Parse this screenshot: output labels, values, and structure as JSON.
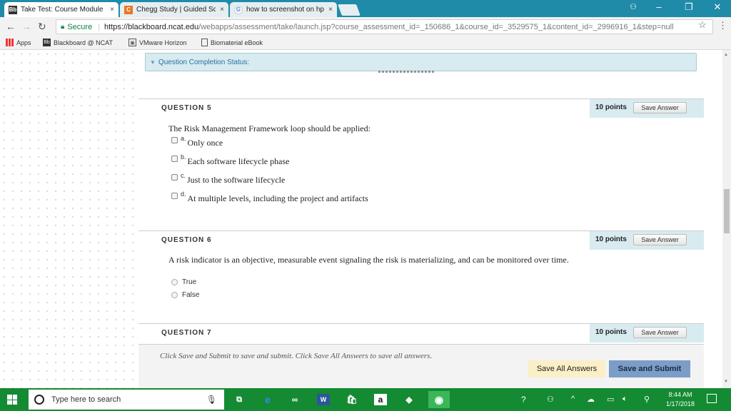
{
  "browser": {
    "tabs": [
      {
        "title": "Take Test: Course Module",
        "favicon": "Bb",
        "active": true
      },
      {
        "title": "Chegg Study | Guided Sc",
        "favicon": "C",
        "active": false
      },
      {
        "title": "how to screenshot on hp",
        "favicon": "G",
        "active": false
      }
    ],
    "tab_close": "×",
    "omnibox": {
      "secure_label": "Secure",
      "url_host": "https://blackboard.ncat.edu",
      "url_rest": "/webapps/assessment/take/launch.jsp?course_assessment_id=_150686_1&course_id=_3529575_1&content_id=_2996916_1&step=null"
    },
    "bookmarks": [
      {
        "label": "Apps",
        "icon": "apps-grid-icon"
      },
      {
        "label": "Blackboard @ NCAT",
        "icon": "blackboard-icon"
      },
      {
        "label": "VMware Horizon",
        "icon": "vmware-icon"
      },
      {
        "label": "Biomaterial eBook",
        "icon": "page-icon"
      }
    ]
  },
  "test": {
    "completion_status_label": "Question Completion Status:",
    "questions": [
      {
        "label": "QUESTION 5",
        "points": "10 points",
        "save_label": "Save Answer",
        "text": "The Risk Management Framework loop should be applied:",
        "type": "checkbox",
        "options": [
          {
            "letter": "a.",
            "text": "Only once"
          },
          {
            "letter": "b.",
            "text": "Each software lifecycle phase"
          },
          {
            "letter": "c.",
            "text": "Just to the software lifecycle"
          },
          {
            "letter": "d.",
            "text": "At multiple levels, including the project and artifacts"
          }
        ]
      },
      {
        "label": "QUESTION 6",
        "points": "10 points",
        "save_label": "Save Answer",
        "text": "A risk indicator is an objective, measurable event signaling the risk is materializing, and can be monitored over time.",
        "type": "radio",
        "options": [
          {
            "text": "True"
          },
          {
            "text": "False"
          }
        ]
      },
      {
        "label": "QUESTION 7",
        "points": "10 points",
        "save_label": "Save Answer"
      }
    ],
    "submit_message": "Click Save and Submit to save and submit. Click Save All Answers to save all answers.",
    "save_all_label": "Save All Answers",
    "save_submit_label": "Save and Submit"
  },
  "taskbar": {
    "search_placeholder": "Type here to search",
    "time": "8:44 AM",
    "date": "1/17/2018"
  },
  "colors": {
    "tabstrip": "#1f8ba8",
    "taskbar": "#148a33",
    "points_panel": "#d7ebf0",
    "save_submit": "#7b9dc7",
    "save_all": "#fbefc7"
  }
}
